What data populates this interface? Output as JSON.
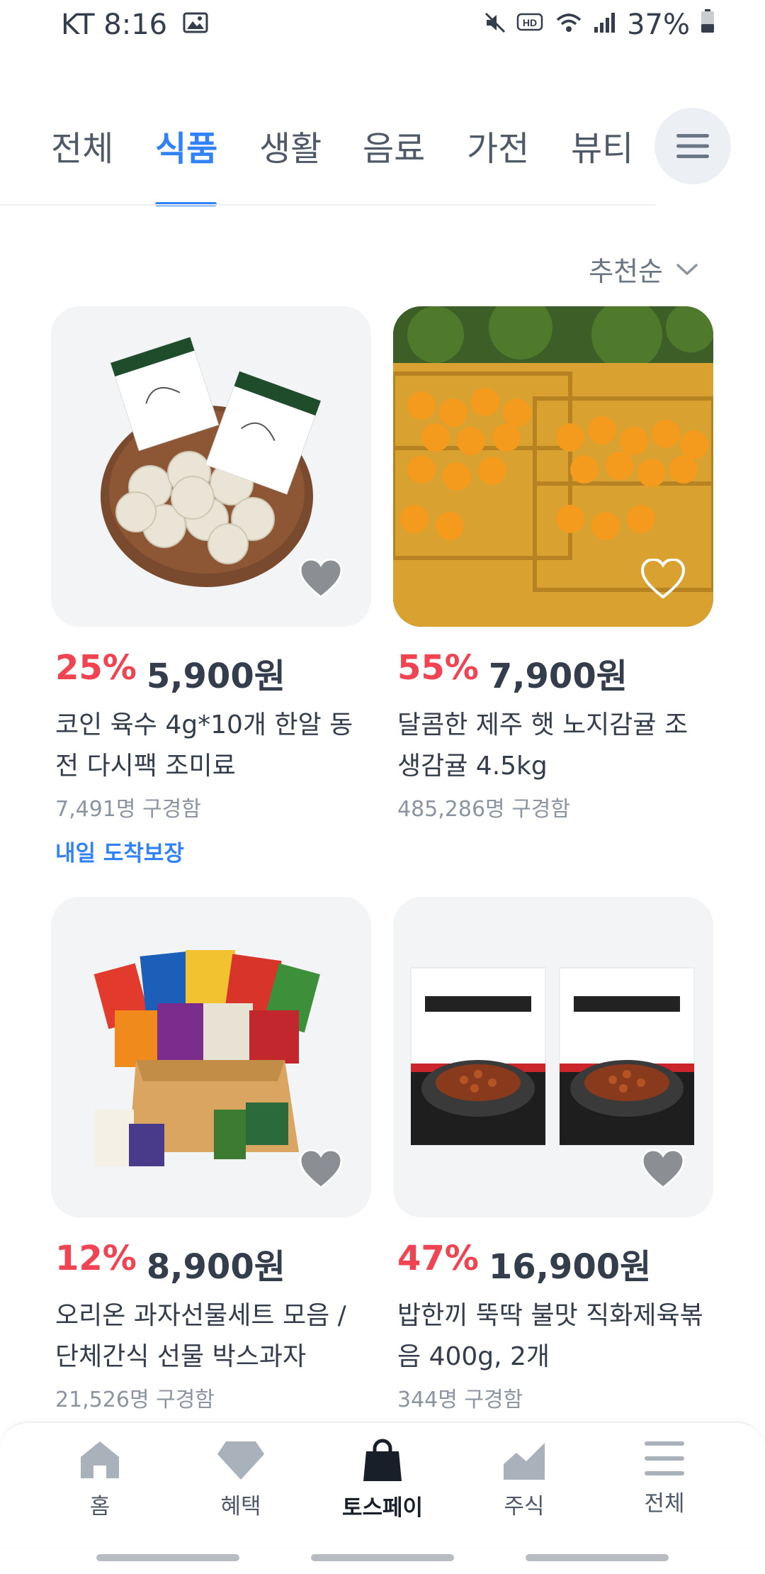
{
  "status_bar": {
    "carrier_time": "KT 8:16",
    "battery": "37%"
  },
  "categories": {
    "tabs": [
      "전체",
      "식품",
      "생활",
      "음료",
      "가전",
      "뷰티"
    ],
    "active": "식품"
  },
  "sort": {
    "label": "추천순"
  },
  "products": [
    {
      "discount": "25%",
      "price": "5,900원",
      "title": "코인 육수 4g*10개 한알 동전 다시팩 조미료",
      "buyers": "7,491명 구경함",
      "delivery": "내일 도착보장"
    },
    {
      "discount": "55%",
      "price": "7,900원",
      "title": "달콤한 제주 햇 노지감귤 조생감귤 4.5kg",
      "buyers": "485,286명 구경함"
    },
    {
      "discount": "12%",
      "price": "8,900원",
      "title": "오리온 과자선물세트 모음 / 단체간식 선물 박스과자",
      "buyers": "21,526명 구경함"
    },
    {
      "discount": "47%",
      "price": "16,900원",
      "title": "밥한끼 뚝딱 불맛 직화제육볶음 400g, 2개",
      "buyers": "344명 구경함"
    }
  ],
  "bottom_nav": {
    "items": [
      "홈",
      "혜택",
      "토스페이",
      "주식",
      "전체"
    ],
    "active": "토스페이"
  },
  "colors": {
    "accent": "#3182f6",
    "discount": "#f04452",
    "text": "#333d4b"
  }
}
